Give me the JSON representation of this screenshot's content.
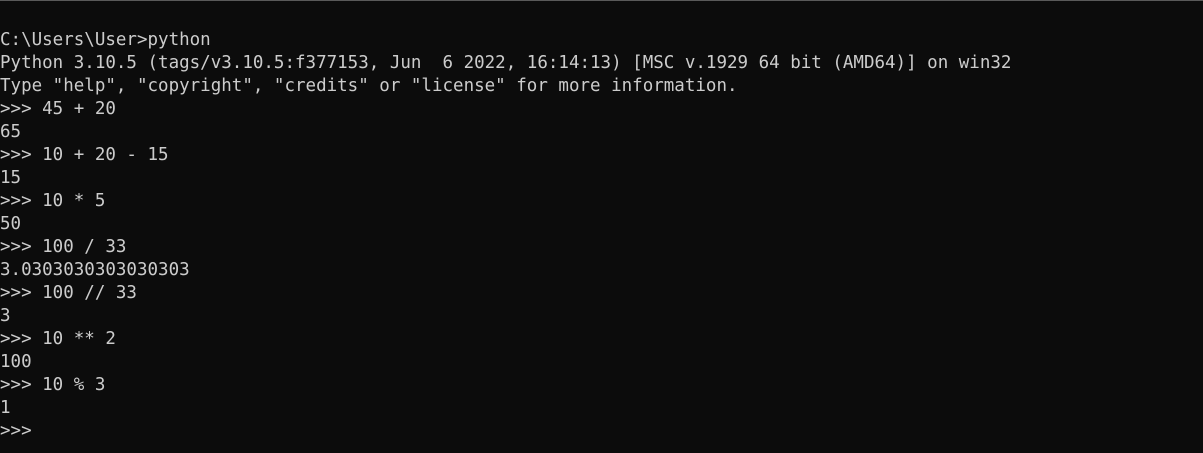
{
  "terminal": {
    "lines": [
      "C:\\Users\\User>python",
      "Python 3.10.5 (tags/v3.10.5:f377153, Jun  6 2022, 16:14:13) [MSC v.1929 64 bit (AMD64)] on win32",
      "Type \"help\", \"copyright\", \"credits\" or \"license\" for more information.",
      ">>> 45 + 20",
      "65",
      ">>> 10 + 20 - 15",
      "15",
      ">>> 10 * 5",
      "50",
      ">>> 100 / 33",
      "3.0303030303030303",
      ">>> 100 // 33",
      "3",
      ">>> 10 ** 2",
      "100",
      ">>> 10 % 3",
      "1",
      ">>>"
    ],
    "colors": {
      "background": "#0c0c0c",
      "text": "#cccccc"
    }
  }
}
